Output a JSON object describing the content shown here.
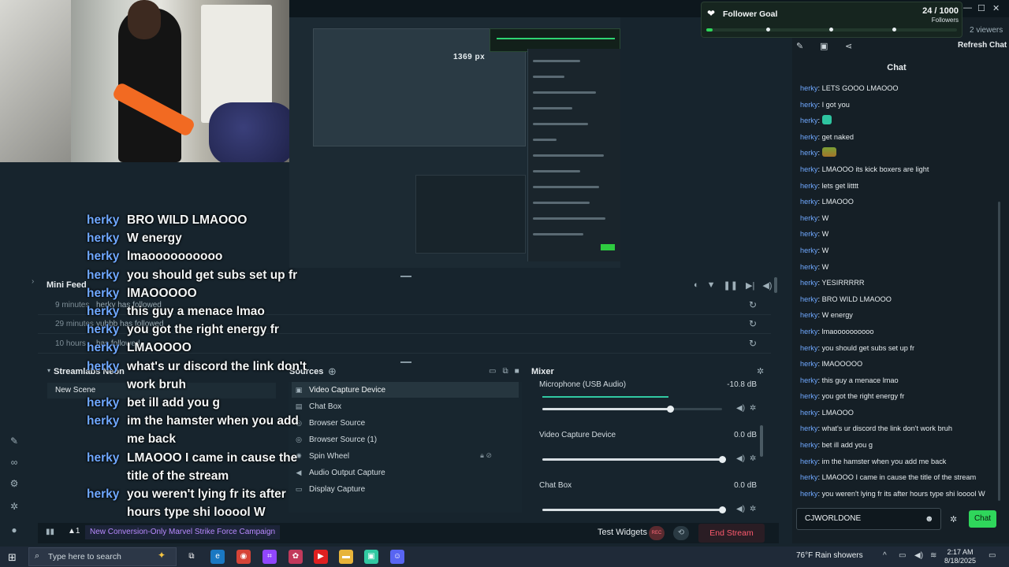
{
  "preview": {
    "px_label": "1369 px"
  },
  "overlay_chat": [
    {
      "user": "herky",
      "msg": "BRO WILD LMAOOO"
    },
    {
      "user": "herky",
      "msg": "W energy"
    },
    {
      "user": "herky",
      "msg": "lmaoooooooooo"
    },
    {
      "user": "herky",
      "msg": "you should get subs set up fr"
    },
    {
      "user": "herky",
      "msg": "lMAOOOOO"
    },
    {
      "user": "herky",
      "msg": "this guy a menace lmao"
    },
    {
      "user": "herky",
      "msg": "you got the right energy fr"
    },
    {
      "user": "herky",
      "msg": "LMAOOOO"
    },
    {
      "user": "herky",
      "msg": "what's ur discord the link don't work bruh"
    },
    {
      "user": "herky",
      "msg": "bet ill add you g"
    },
    {
      "user": "herky",
      "msg": "im the hamster when you add me back"
    },
    {
      "user": "herky",
      "msg": "LMAOOO I came in cause the title of the stream"
    },
    {
      "user": "herky",
      "msg": "you weren't lying fr its after hours type shi looool W"
    }
  ],
  "mini_feed": {
    "title": "Mini Feed",
    "events": [
      {
        "time": "9 minutes",
        "user": "herky",
        "action": "has followed"
      },
      {
        "time": "29 minutes",
        "user": "yubbb",
        "action": "has followed"
      },
      {
        "time": "10 hours",
        "user": "",
        "action": "has followed"
      }
    ]
  },
  "scenes": {
    "title": "Streamlabs Neon",
    "items": [
      "New Scene"
    ]
  },
  "sources": {
    "title": "Sources",
    "items": [
      "Video Capture Device",
      "Chat Box",
      "Browser Source",
      "Browser Source (1)",
      "Spin Wheel",
      "Audio Output Capture",
      "Display Capture"
    ]
  },
  "mixer": {
    "title": "Mixer",
    "channels": [
      {
        "name": "Microphone (USB Audio)",
        "db": "-10.8 dB",
        "level": 0.71
      },
      {
        "name": "Video Capture Device",
        "db": "0.0 dB",
        "level": 1.0
      },
      {
        "name": "Chat Box",
        "db": "0.0 dB",
        "level": 1.0
      }
    ]
  },
  "status_bar": {
    "alert_count": "1",
    "promo": "New Conversion-Only Marvel Strike Force Campaign",
    "test_widgets": "Test Widgets",
    "rec": "REC",
    "end_stream": "End Stream"
  },
  "follower_goal": {
    "title": "Follower Goal",
    "count": "24 / 1000",
    "label": "Followers",
    "progress": 0.024
  },
  "viewers": "2 viewers",
  "chat": {
    "refresh": "Refresh Chat",
    "title": "Chat",
    "messages": [
      {
        "user": "herky",
        "msg": "LETS GOOO LMAOOO"
      },
      {
        "user": "herky",
        "msg": "I got you"
      },
      {
        "user": "herky",
        "msg": "",
        "emoji": "a"
      },
      {
        "user": "herky",
        "msg": "get naked"
      },
      {
        "user": "herky",
        "msg": "",
        "emoji": "b"
      },
      {
        "user": "herky",
        "msg": "LMAOOO its kick boxers are light"
      },
      {
        "user": "herky",
        "msg": "lets get litttt"
      },
      {
        "user": "herky",
        "msg": "LMAOOO"
      },
      {
        "user": "herky",
        "msg": "W"
      },
      {
        "user": "herky",
        "msg": "W"
      },
      {
        "user": "herky",
        "msg": "W"
      },
      {
        "user": "herky",
        "msg": "W"
      },
      {
        "user": "herky",
        "msg": "YESIRRRRR"
      },
      {
        "user": "herky",
        "msg": "BRO WILD LMAOOO"
      },
      {
        "user": "herky",
        "msg": "W energy"
      },
      {
        "user": "herky",
        "msg": "lmaoooooooooo"
      },
      {
        "user": "herky",
        "msg": "you should get subs set up fr"
      },
      {
        "user": "herky",
        "msg": "lMAOOOOO"
      },
      {
        "user": "herky",
        "msg": "this guy a menace lmao"
      },
      {
        "user": "herky",
        "msg": "you got the right energy fr"
      },
      {
        "user": "herky",
        "msg": "LMAOOO"
      },
      {
        "user": "herky",
        "msg": "what's ur discord the link don't work bruh"
      },
      {
        "user": "herky",
        "msg": "bet ill add you g"
      },
      {
        "user": "herky",
        "msg": "im the hamster when you add me back"
      },
      {
        "user": "herky",
        "msg": "LMAOOO I came in cause the title of the stream"
      },
      {
        "user": "herky",
        "msg": "you weren't lying fr its after hours type shi looool W"
      }
    ],
    "input_value": "CJWORLDONE",
    "send": "Chat"
  },
  "taskbar": {
    "search_placeholder": "Type here to search",
    "weather": "76°F  Rain showers",
    "time": "2:17 AM",
    "date": "8/18/2025"
  },
  "icons": {
    "search": "search-icon",
    "gear": "gear-icon",
    "refresh": "refresh-icon",
    "mute": "speaker-icon"
  },
  "colors": {
    "accent_green": "#2fd65b",
    "username_blue": "#6fa8ff",
    "end_stream_red": "#ff5a6e"
  }
}
